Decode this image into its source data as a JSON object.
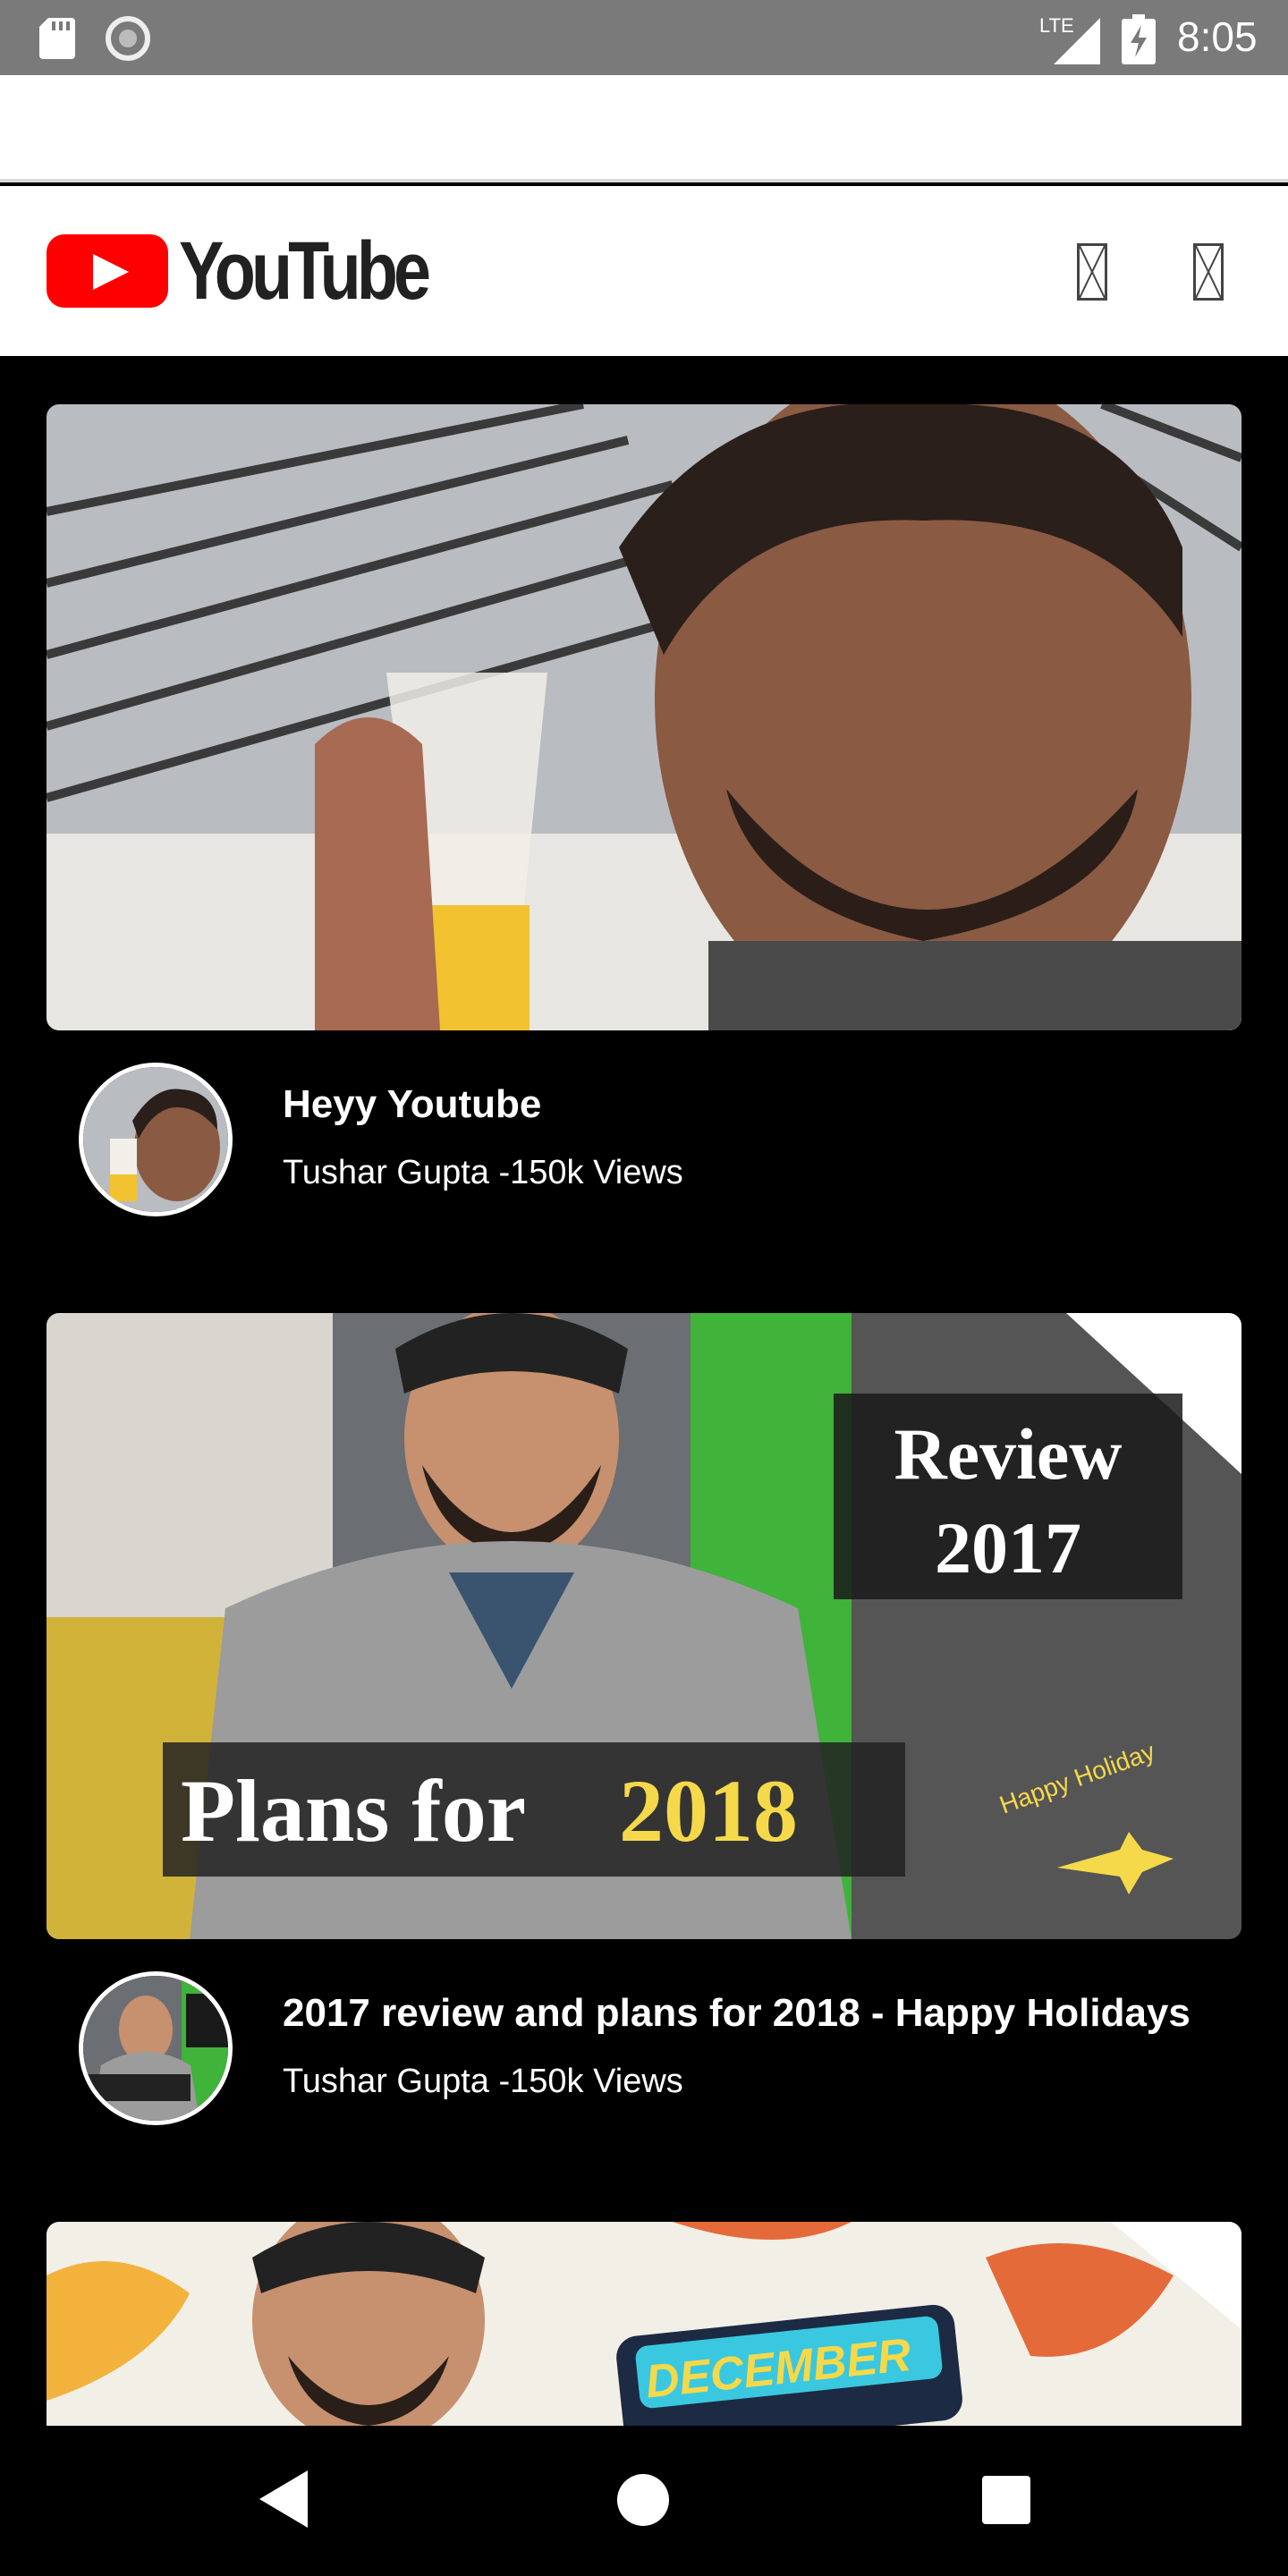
{
  "status_bar": {
    "time": "8:05",
    "network": "LTE"
  },
  "app": {
    "brand": "YouTube",
    "brand_color": "#ff0000"
  },
  "videos": [
    {
      "title": "Heyy Youtube",
      "meta": "Tushar Gupta -150k Views"
    },
    {
      "title": "2017 review and plans for 2018 - Happy Holidays",
      "meta": "Tushar Gupta -150k Views",
      "thumb_text": {
        "review": "Review",
        "year": "2017",
        "plans": "Plans for",
        "plans_year": "2018",
        "ribbon": "Happy Holiday"
      }
    },
    {
      "thumb_text": {
        "banner": "DECEMBER"
      }
    }
  ],
  "icons": {
    "sd_card": "sd-card-icon",
    "record": "record-icon",
    "signal": "lte-signal-icon",
    "battery": "battery-charging-icon",
    "action_a": "missing-icon",
    "action_b": "missing-icon",
    "back": "back-icon",
    "home": "home-icon",
    "recents": "recents-icon"
  }
}
